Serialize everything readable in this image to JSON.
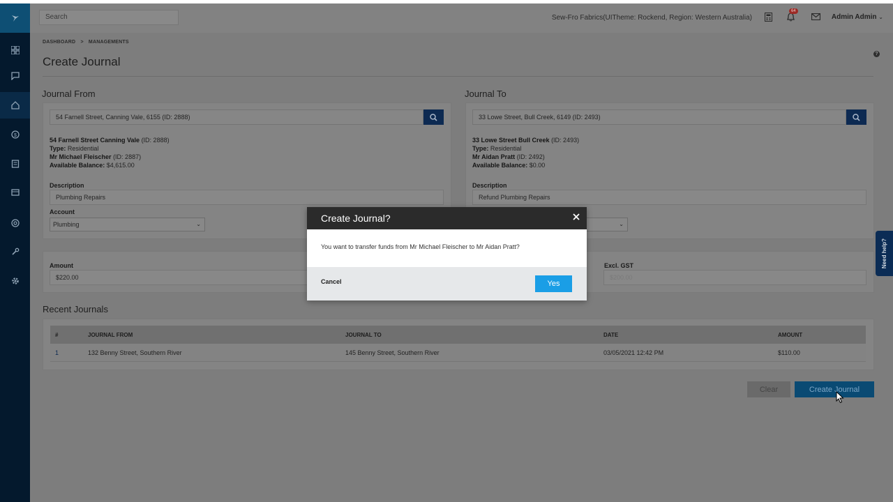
{
  "header": {
    "search_placeholder": "Search",
    "theme_info": "Sew-Fro Fabrics(UITheme: Rockend, Region: Western Australia)",
    "notification_count": "64",
    "user_name": "Admin Admin"
  },
  "breadcrumb": {
    "item1": "DASHBOARD",
    "separator": ">",
    "item2": "MANAGEMENTS"
  },
  "page": {
    "title": "Create Journal"
  },
  "journal_from": {
    "section_title": "Journal From",
    "property_value": "54 Farnell Street, Canning Vale, 6155 (ID: 2888)",
    "property_name": "54 Farnell Street Canning Vale",
    "property_id": "(ID: 2888)",
    "type_label": "Type:",
    "type_value": "Residential",
    "owner_name": "Mr Michael Fleischer",
    "owner_id": "(ID: 2887)",
    "balance_label": "Available Balance:",
    "balance_value": "$4,615.00",
    "description_label": "Description",
    "description_value": "Plumbing Repairs",
    "account_label": "Account",
    "account_value": "Plumbing"
  },
  "journal_to": {
    "section_title": "Journal To",
    "property_value": "33 Lowe Street, Bull Creek, 6149 (ID: 2493)",
    "property_name": "33 Lowe Street Bull Creek",
    "property_id": "(ID: 2493)",
    "type_label": "Type:",
    "type_value": "Residential",
    "owner_name": "Mr Aidan Pratt",
    "owner_id": "(ID: 2492)",
    "balance_label": "Available Balance:",
    "balance_value": "$0.00",
    "description_label": "Description",
    "description_value": "Refund Plumbing Repairs"
  },
  "amounts": {
    "amount_label": "Amount",
    "amount_value": "$220.00",
    "excl_gst_label": "Excl. GST",
    "excl_gst_value": "$200.00"
  },
  "recent_journals": {
    "section_title": "Recent Journals",
    "columns": [
      "#",
      "JOURNAL FROM",
      "JOURNAL TO",
      "DATE",
      "AMOUNT"
    ],
    "rows": [
      {
        "num": "1",
        "from": "132 Benny Street, Southern River",
        "to": "145 Benny Street, Southern River",
        "date": "03/05/2021 12:42 PM",
        "amount": "$110.00"
      }
    ]
  },
  "actions": {
    "clear_label": "Clear",
    "create_label": "Create Journal"
  },
  "need_help": "Need help?",
  "help_icon_glyph": "?",
  "modal": {
    "title": "Create Journal?",
    "message": "You want to transfer funds from Mr Michael Fleischer to Mr Aidan Pratt?",
    "cancel_label": "Cancel",
    "yes_label": "Yes"
  },
  "colors": {
    "sidebar": "#04192d",
    "primary_button": "#1a9ee6",
    "modal_header": "#2b2b2b"
  }
}
